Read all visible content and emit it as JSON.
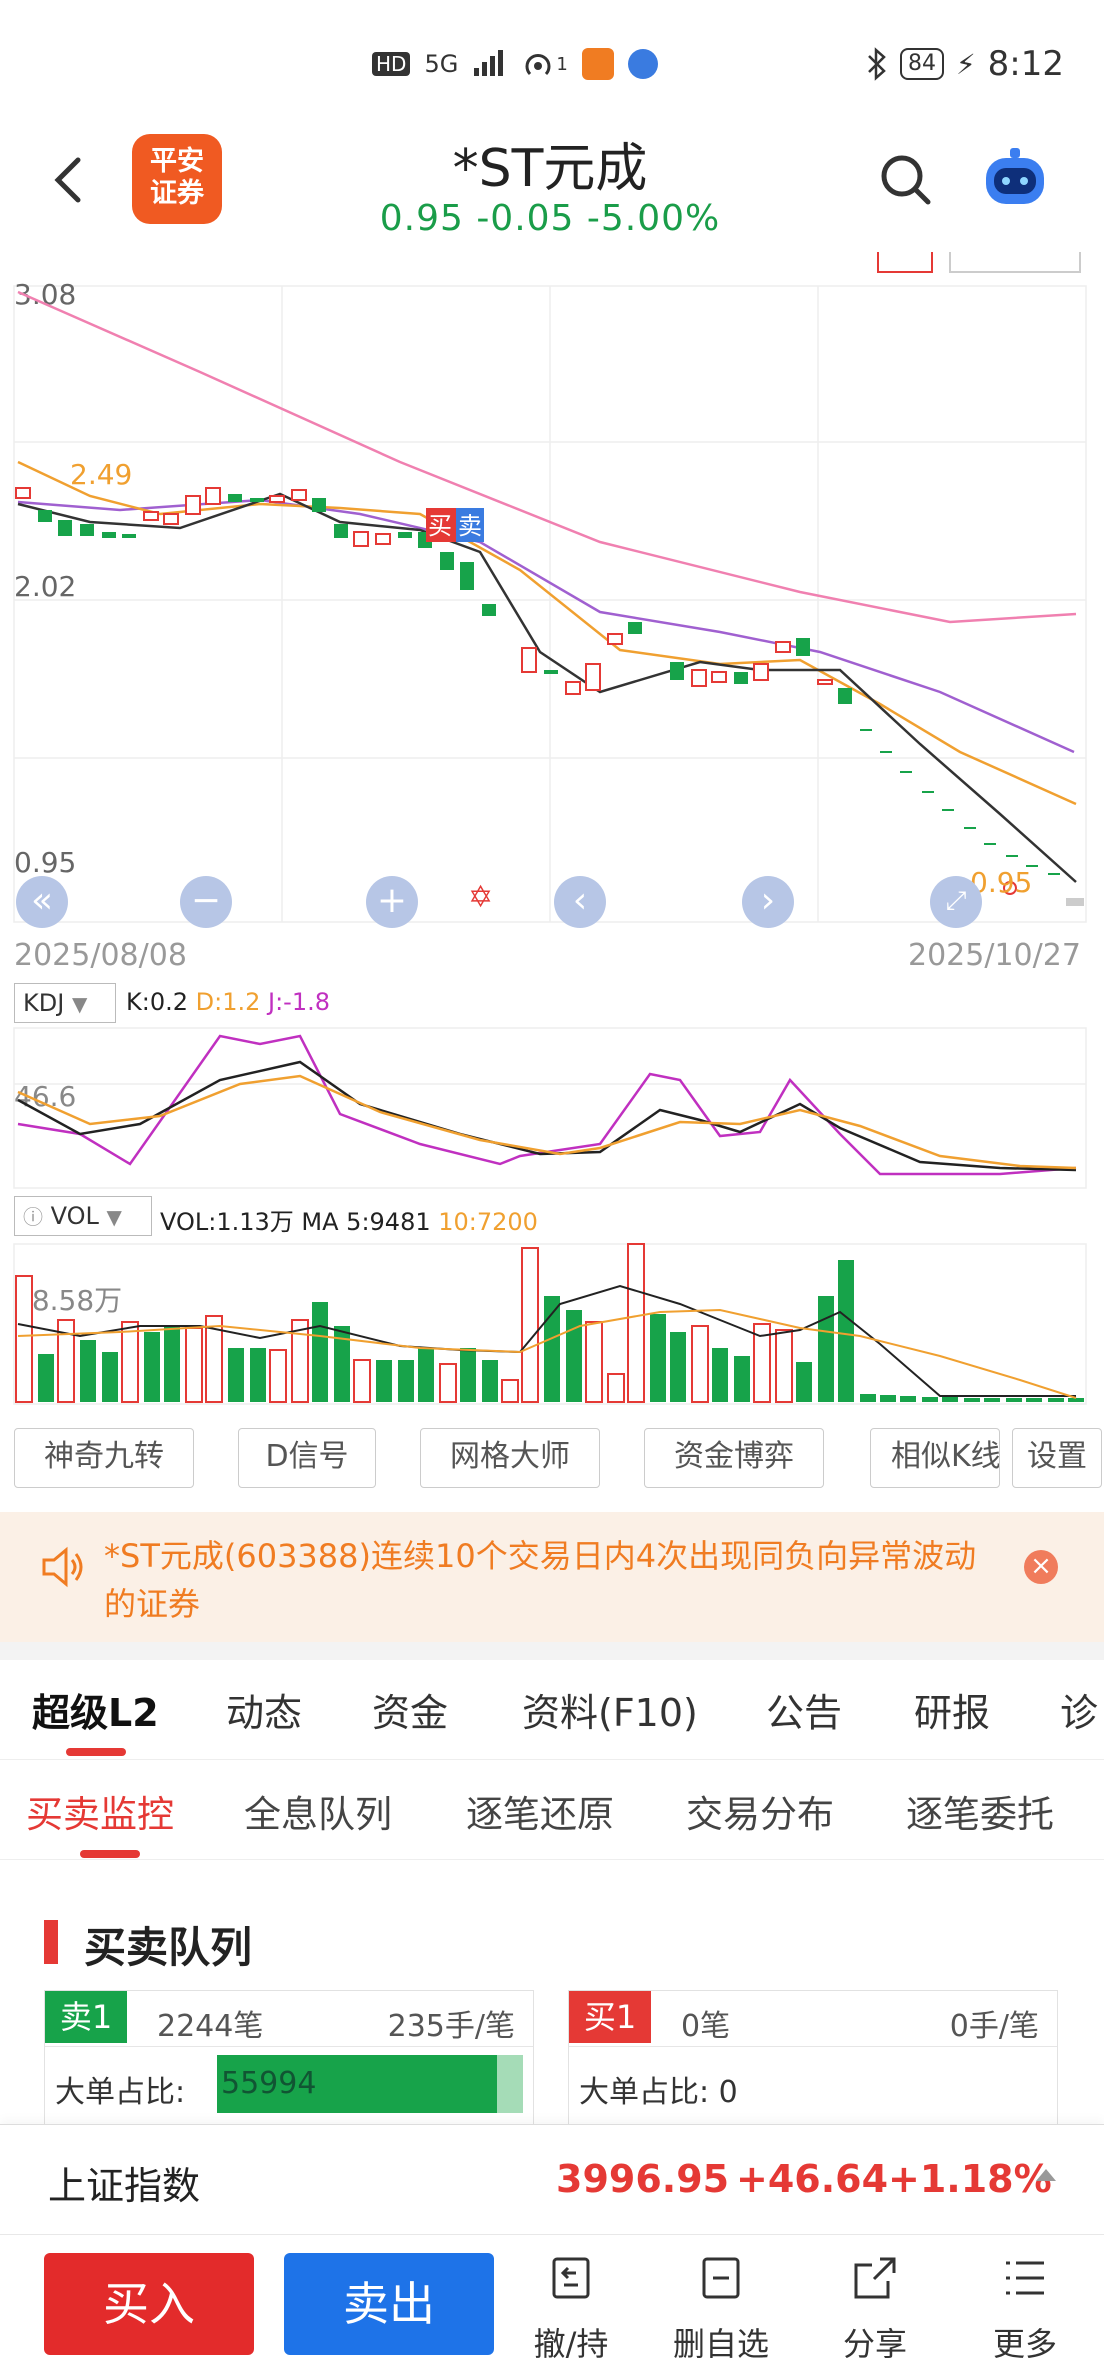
{
  "status_bar": {
    "hd": "HD",
    "net": "5G",
    "sim_tag": "1",
    "battery": "84",
    "time": "8:12"
  },
  "header": {
    "logo_line1": "平安",
    "logo_line2": "证券",
    "stock_name": "*ST元成",
    "quote": "0.95  -0.05  -5.00%"
  },
  "kline": {
    "y_high": "3.08",
    "y_mid": "2.02",
    "y_low": "0.95",
    "ma_level": "2.49",
    "end_mark": "0.95",
    "date_start": "2025/08/08",
    "date_end": "2025/10/27",
    "buy_flag": "买",
    "sell_flag": "卖"
  },
  "kdj": {
    "label": "KDJ",
    "k": "K:0.2",
    "d": "D:1.2",
    "j": "J:-1.8",
    "level": "46.6"
  },
  "vol": {
    "label": "VOL",
    "vol": "VOL:1.13万",
    "ma5": "MA 5:9481",
    "ma10": "10:7200",
    "level": "18.58万"
  },
  "tools": [
    "神奇九转",
    "D信号",
    "网格大师",
    "资金博弈",
    "相似K线",
    "设置"
  ],
  "notice": {
    "text": "*ST元成(603388)连续10个交易日内4次出现同负向异常波动的证券"
  },
  "tabs_main": [
    "超级L2",
    "动态",
    "资金",
    "资料(F10)",
    "公告",
    "研报",
    "诊"
  ],
  "tabs_sub": [
    "买卖监控",
    "全息队列",
    "逐笔还原",
    "交易分布",
    "逐笔委托"
  ],
  "queue": {
    "title": "买卖队列",
    "sell": {
      "tag": "卖1",
      "count": "2244笔",
      "per": "235手/笔",
      "big_label": "大单占比:",
      "big_value": "55994"
    },
    "buy": {
      "tag": "买1",
      "count": "0笔",
      "per": "0手/笔",
      "big_label": "大单占比:",
      "big_value": "0"
    }
  },
  "index": {
    "name": "上证指数",
    "value": "3996.95",
    "change": "+46.64",
    "pct": "+1.18%"
  },
  "bottom_nav": {
    "buy": "买入",
    "sell": "卖出",
    "items": [
      "撤/持",
      "删自选",
      "分享",
      "更多"
    ]
  },
  "colors": {
    "up": "#e53935",
    "down": "#17a34a",
    "ma5": "#333333",
    "ma10": "#f0a030",
    "ma20": "#a060d0",
    "ma60": "#f080b0"
  }
}
